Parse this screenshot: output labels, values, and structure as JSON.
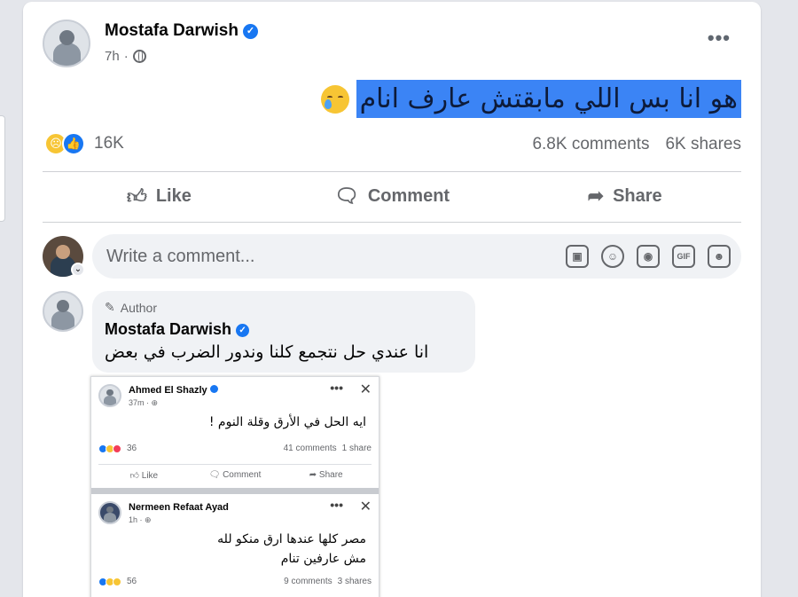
{
  "post": {
    "author": "Mostafa Darwish",
    "time": "7h",
    "time_sep": "·",
    "more": "•••",
    "text": "هو انا بس اللي مابقتش عارف انام",
    "reaction_count": "16K",
    "comments": "6.8K comments",
    "shares": "6K shares",
    "verified_mark": "✓"
  },
  "actions": {
    "like": "Like",
    "comment": "Comment",
    "share": "Share"
  },
  "comment_box": {
    "placeholder": "Write a comment...",
    "caret": "⌄",
    "icons": [
      "sticker-icon",
      "emoji-icon",
      "camera-icon",
      "gif-icon",
      "sticker-face-icon"
    ],
    "gif": "GIF"
  },
  "comment": {
    "tag": "Author",
    "name": "Mostafa Darwish",
    "text": "انا عندي حل نتجمع كلنا وندور الضرب في بعض"
  },
  "screenshot": {
    "post1": {
      "name": "Ahmed El Shazly",
      "time": "37m · ",
      "text": "ايه الحل في الأرق وقلة النوم !",
      "reactions": "36",
      "stats": [
        "41 comments",
        "1 share"
      ],
      "actions": [
        "Like",
        "Comment",
        "Share"
      ]
    },
    "post2": {
      "name": "Nermeen Refaat Ayad",
      "time": "1h · ",
      "text_line1": "مصر كلها عندها ارق منكو لله",
      "text_line2": "مش عارفين تنام",
      "reactions": "56",
      "stats": [
        "9 comments",
        "3 shares"
      ]
    },
    "dots": "•••",
    "close": "✕"
  },
  "colors": {
    "accent": "#1877f2",
    "highlight": "#3b84f5",
    "muted": "#65676b"
  }
}
